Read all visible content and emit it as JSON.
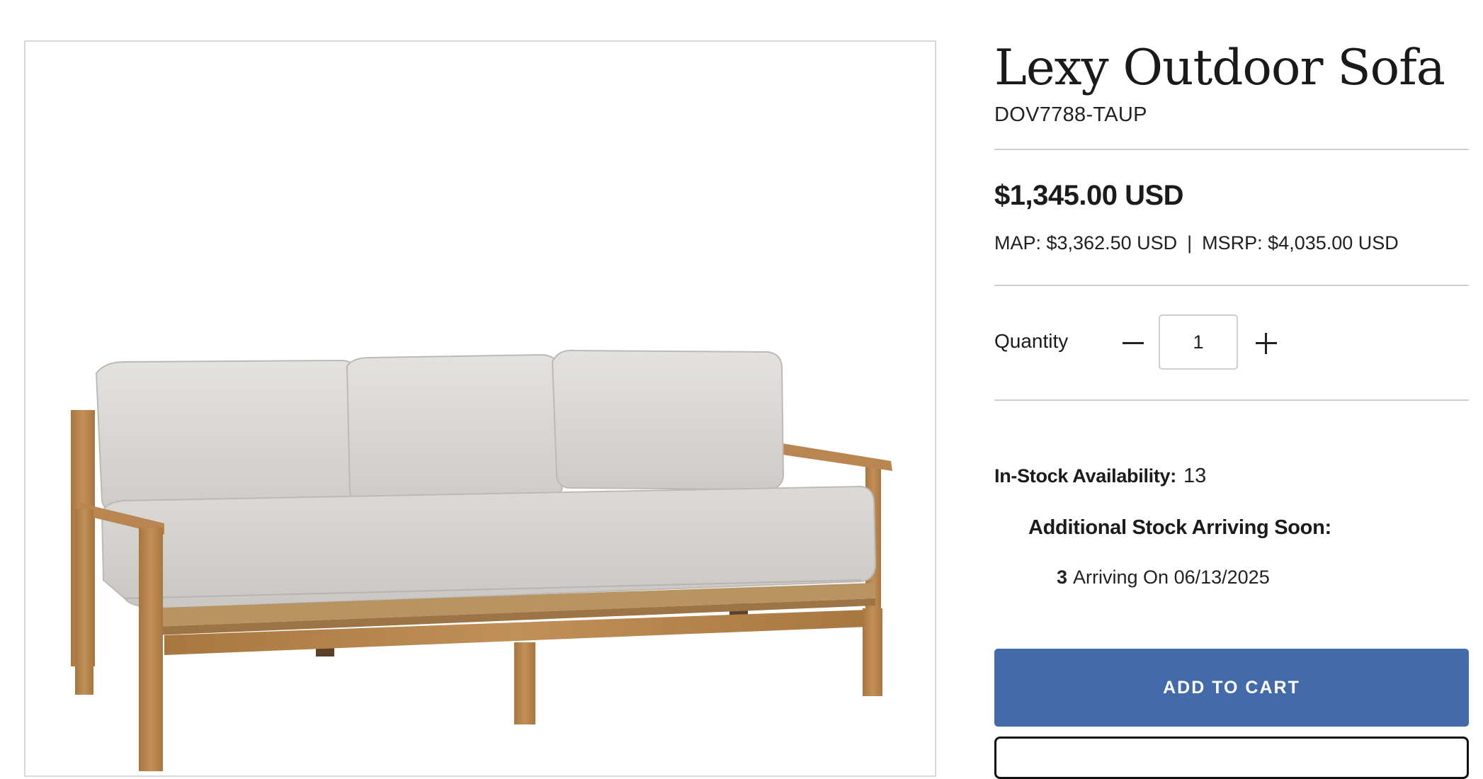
{
  "product": {
    "title": "Lexy Outdoor Sofa",
    "sku": "DOV7788-TAUP",
    "image_alt": "sofa-photo"
  },
  "pricing": {
    "price": "$1,345.00 USD",
    "map": "MAP: $3,362.50 USD",
    "separator": "|",
    "msrp": "MSRP: $4,035.00 USD"
  },
  "quantity": {
    "label": "Quantity",
    "value": "1",
    "minus_icon": "minus-icon",
    "plus_icon": "plus-icon"
  },
  "availability": {
    "label": "In-Stock Availability:",
    "value": "13",
    "arriving_heading": "Additional Stock Arriving Soon:",
    "arrivals": [
      {
        "qty": "3",
        "text": "Arriving On 06/13/2025"
      }
    ]
  },
  "actions": {
    "add_to_cart": "ADD TO CART"
  },
  "colors": {
    "accent": "#436baa",
    "divider": "#cfcfcf",
    "wood": "#b7864f",
    "cushion": "#d8d6d3"
  }
}
